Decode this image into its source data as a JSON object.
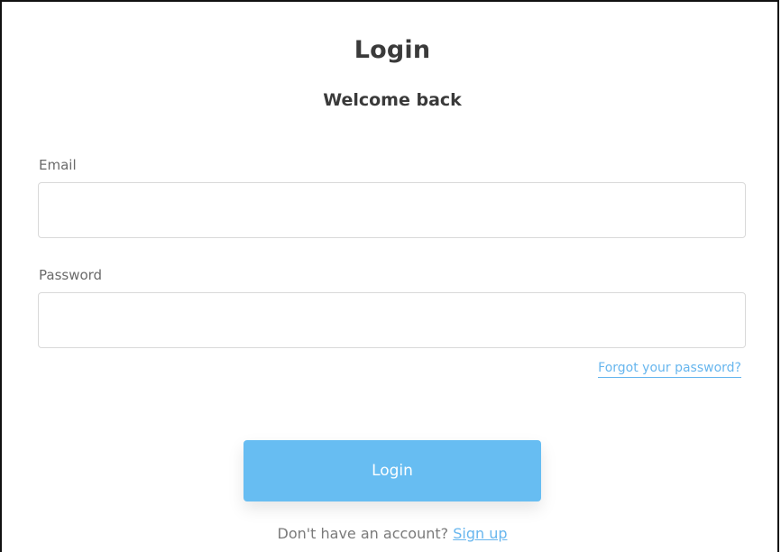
{
  "header": {
    "title": "Login",
    "subtitle": "Welcome back"
  },
  "form": {
    "email_label": "Email",
    "email_value": "",
    "email_placeholder": "",
    "password_label": "Password",
    "password_value": "",
    "password_placeholder": "",
    "forgot_link": "Forgot your password?",
    "submit_label": "Login"
  },
  "footer": {
    "prompt": "Don't have an account?",
    "signup_link": "Sign up"
  },
  "colors": {
    "accent": "#67bdf2",
    "link": "#67b6ee",
    "text": "#3a3a3a",
    "muted": "#7a7a7a"
  }
}
